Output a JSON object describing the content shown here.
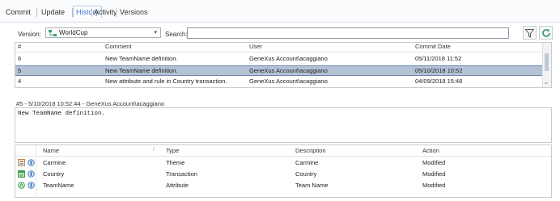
{
  "tabs": [
    "Commit",
    "Update",
    "History",
    "Activity",
    "Versions"
  ],
  "toolbar": {
    "version_label": "Version:",
    "version_value": "WorldCup",
    "search_label": "Search:",
    "search_value": ""
  },
  "history": {
    "columns": [
      "#",
      "Comment",
      "User",
      "Commit Date"
    ],
    "rows": [
      {
        "num": "6",
        "comment": "New TeamName definition.",
        "user": "GeneXus Account\\acaggiano",
        "date": "05/11/2018 11:52"
      },
      {
        "num": "5",
        "comment": "New TeamName definition.",
        "user": "GeneXus Account\\acaggiano",
        "date": "05/10/2018 10:52"
      },
      {
        "num": "4",
        "comment": "New attribute and rule in Country transaction.",
        "user": "GeneXus Account\\acaggiano",
        "date": "04/09/2018 15:48"
      }
    ],
    "selected_index": 1
  },
  "detail": {
    "header": "#5 - 5/10/2018 10:52:44 - GeneXus Account\\acaggiano",
    "comment": "New TeamName definition."
  },
  "objects": {
    "columns": [
      "Name",
      "Type",
      "Description",
      "Action"
    ],
    "rows": [
      {
        "icon": "theme-icon",
        "name": "Carmine",
        "type": "Theme",
        "description": "Carmine",
        "action": "Modified"
      },
      {
        "icon": "transaction-icon",
        "name": "Country",
        "type": "Transaction",
        "description": "Country",
        "action": "Modified"
      },
      {
        "icon": "attribute-icon",
        "name": "TeamName",
        "type": "Attribute",
        "description": "Team Name",
        "action": "Modified"
      }
    ]
  },
  "colors": {
    "accent": "#3d78d8",
    "selection": "#b4c2d6"
  }
}
